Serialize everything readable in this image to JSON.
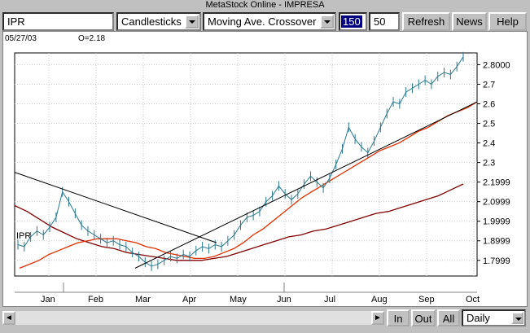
{
  "window": {
    "title": "MetaStock Online - IMPRESA"
  },
  "toolbar": {
    "symbol": "IPR",
    "chart_style": "Candlesticks",
    "indicator": "Moving Ave. Crossover",
    "period1": "150",
    "period2": "50",
    "refresh_label": "Refresh",
    "news_label": "News",
    "help_label": "Help"
  },
  "chart": {
    "date_readout": "05/27/03",
    "open_readout": "O=2.18",
    "symbol_label": "IPR",
    "y_ticks": [
      "2.8000",
      "2.7",
      "2.6",
      "2.5",
      "2.4",
      "2.3",
      "2.1999",
      "2.0999",
      "1.9999",
      "1.8999",
      "1.7999"
    ],
    "x_ticks": [
      "Jan",
      "Feb",
      "Mar",
      "Apr",
      "May",
      "Jun",
      "Jul",
      "Aug",
      "Sep",
      "Oct"
    ]
  },
  "bottom": {
    "in_label": "In",
    "out_label": "Out",
    "all_label": "All",
    "period_select": "Daily"
  },
  "chart_data": {
    "type": "line",
    "y_range": [
      1.72,
      2.86
    ],
    "x_categories": [
      "Jan",
      "Feb",
      "Mar",
      "Apr",
      "May",
      "Jun",
      "Jul",
      "Aug",
      "Sep",
      "Oct"
    ],
    "price": [
      1.88,
      1.87,
      1.92,
      1.95,
      1.93,
      1.97,
      2.02,
      2.15,
      2.1,
      2.04,
      1.98,
      1.95,
      1.93,
      1.91,
      1.89,
      1.9,
      1.88,
      1.87,
      1.84,
      1.82,
      1.79,
      1.77,
      1.78,
      1.8,
      1.82,
      1.81,
      1.83,
      1.82,
      1.85,
      1.87,
      1.86,
      1.88,
      1.87,
      1.9,
      1.93,
      1.98,
      2.02,
      2.03,
      2.05,
      2.1,
      2.13,
      2.18,
      2.14,
      2.11,
      2.14,
      2.19,
      2.23,
      2.2,
      2.17,
      2.22,
      2.29,
      2.37,
      2.48,
      2.42,
      2.38,
      2.35,
      2.41,
      2.48,
      2.55,
      2.61,
      2.6,
      2.66,
      2.68,
      2.7,
      2.72,
      2.7,
      2.74,
      2.76,
      2.75,
      2.79,
      2.84
    ],
    "ma_short": [
      1.76,
      1.78,
      1.8,
      1.83,
      1.85,
      1.87,
      1.89,
      1.9,
      1.91,
      1.91,
      1.91,
      1.9,
      1.89,
      1.87,
      1.86,
      1.84,
      1.83,
      1.82,
      1.81,
      1.81,
      1.82,
      1.84,
      1.86,
      1.89,
      1.93,
      1.96,
      2.0,
      2.04,
      2.08,
      2.12,
      2.15,
      2.18,
      2.21,
      2.24,
      2.27,
      2.3,
      2.33,
      2.36,
      2.38,
      2.4,
      2.43,
      2.46,
      2.48,
      2.51,
      2.54,
      2.56,
      2.58,
      2.61
    ],
    "ma_long": [
      2.08,
      2.05,
      2.01,
      1.97,
      1.94,
      1.91,
      1.89,
      1.87,
      1.86,
      1.84,
      1.83,
      1.82,
      1.81,
      1.8,
      1.8,
      1.8,
      1.81,
      1.82,
      1.84,
      1.86,
      1.88,
      1.9,
      1.92,
      1.93,
      1.95,
      1.96,
      1.98,
      2.0,
      2.02,
      2.04,
      2.05,
      2.07,
      2.09,
      2.11,
      2.13,
      2.16,
      2.19
    ],
    "trendlines": [
      {
        "from": [
          "Jan-start",
          2.25
        ],
        "to": [
          "Apr-mid",
          1.89
        ]
      },
      {
        "from": [
          "Mar-start",
          1.76
        ],
        "to": [
          "Oct",
          2.61
        ]
      }
    ],
    "ylim": [
      1.72,
      2.86
    ]
  }
}
